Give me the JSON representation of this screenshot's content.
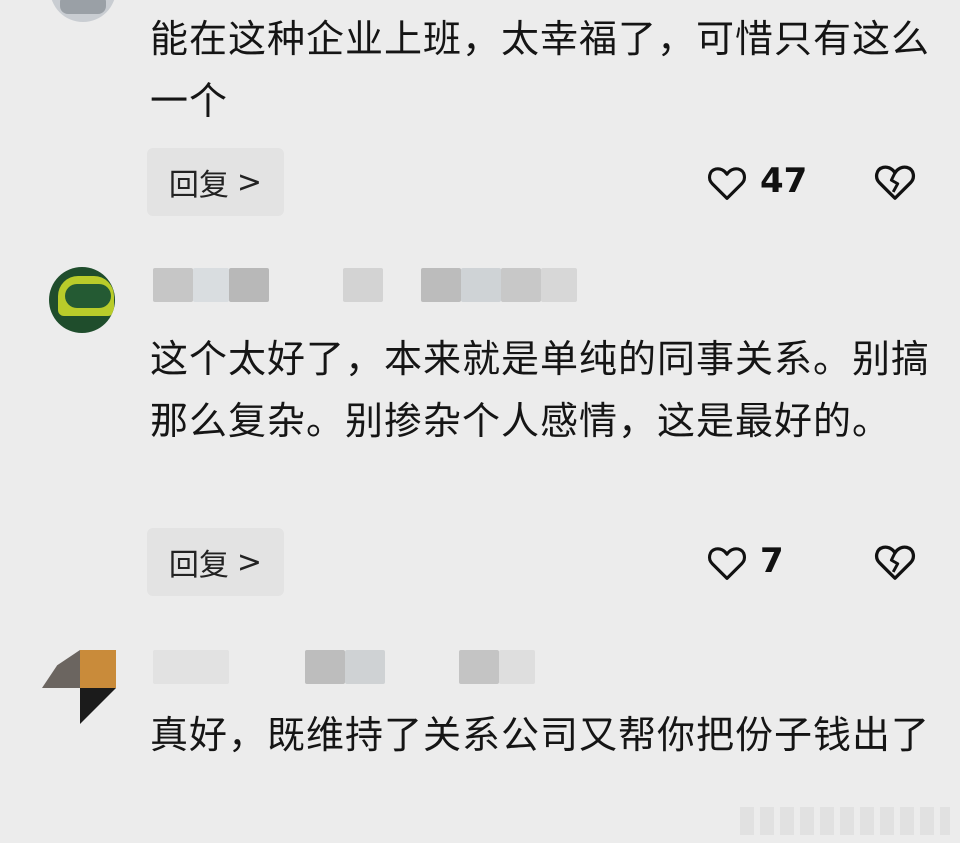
{
  "comments": [
    {
      "text": "能在这种企业上班，太幸福了，可惜只有这么一个",
      "reply_label": "回复",
      "reply_chevron": ">",
      "likes": "47"
    },
    {
      "text": "这个太好了，本来就是单纯的同事关系。别搞那么复杂。别掺杂个人感情，这是最好的。",
      "reply_label": "回复",
      "reply_chevron": ">",
      "likes": "7"
    },
    {
      "text": "真好，既维持了关系公司又帮你把份子钱出了"
    }
  ],
  "icons": {
    "like": "heart-outline-icon",
    "dislike": "broken-heart-icon"
  },
  "colors": {
    "background": "#ececec",
    "reply_button": "#e3e3e3",
    "text": "#151515"
  }
}
